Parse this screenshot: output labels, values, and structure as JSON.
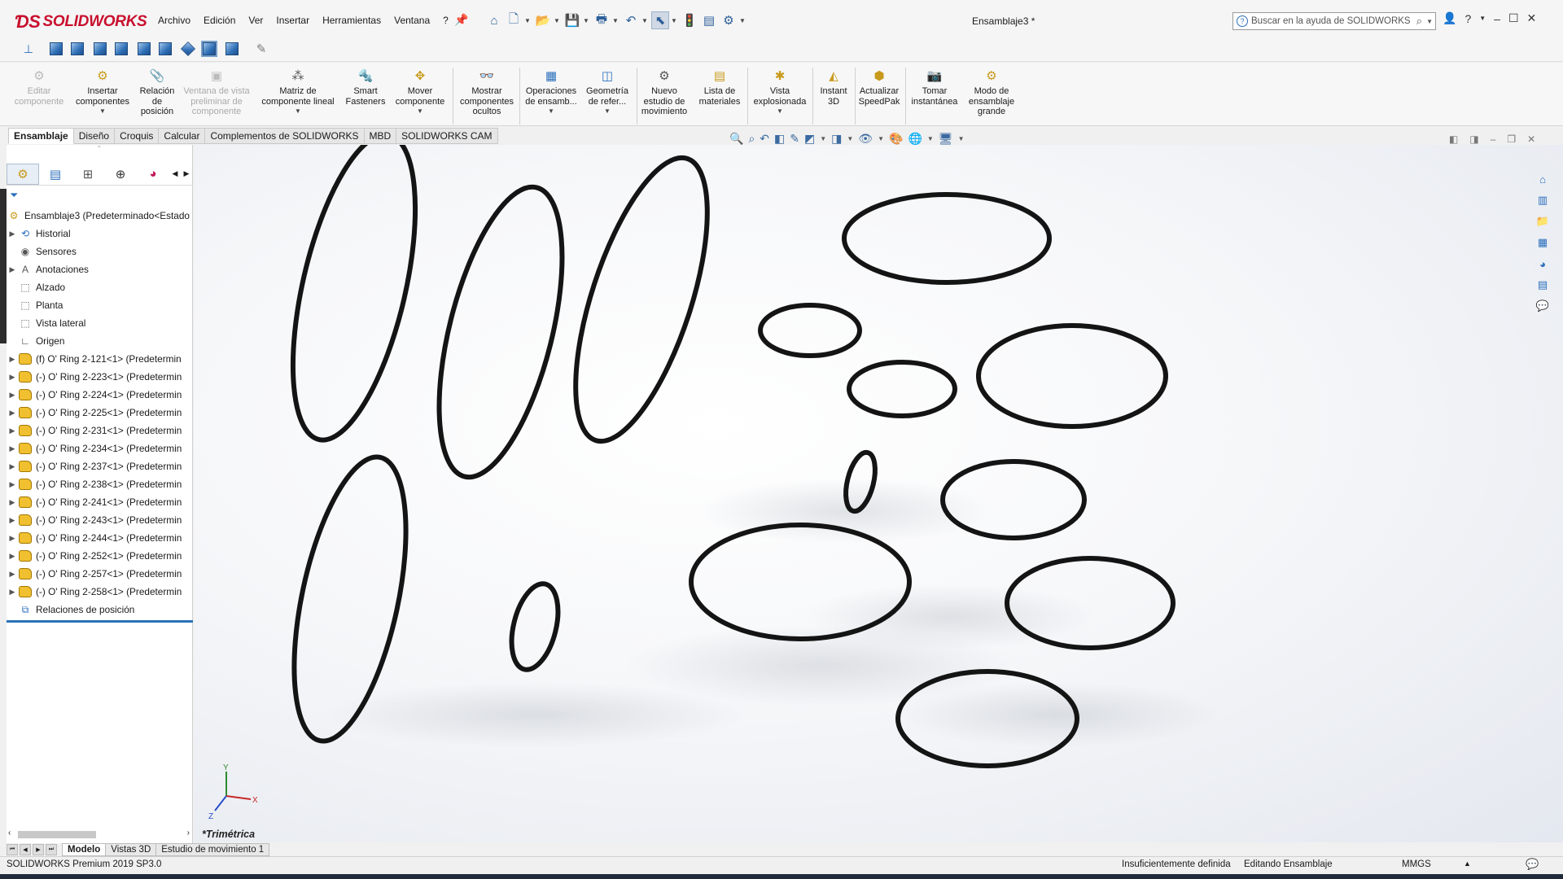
{
  "app": {
    "brand": "SOLIDWORKS",
    "document_title": "Ensamblaje3 *",
    "menu": [
      "Archivo",
      "Edición",
      "Ver",
      "Insertar",
      "Herramientas",
      "Ventana",
      "?"
    ],
    "help_search_placeholder": "Buscar en la ayuda de SOLIDWORKS"
  },
  "command_manager": {
    "items": [
      {
        "label": "Editar componente",
        "enabled": false
      },
      {
        "label": "Insertar componentes",
        "enabled": true
      },
      {
        "label": "Relación de posición",
        "enabled": true
      },
      {
        "label": "Ventana de vista preliminar de componente",
        "enabled": false
      },
      {
        "label": "Matriz de componente lineal",
        "enabled": true
      },
      {
        "label": "Smart Fasteners",
        "enabled": true
      },
      {
        "label": "Mover componente",
        "enabled": true
      },
      {
        "label": "Mostrar componentes ocultos",
        "enabled": true
      },
      {
        "label": "Operaciones de ensamb...",
        "enabled": true
      },
      {
        "label": "Geometría de refer...",
        "enabled": true
      },
      {
        "label": "Nuevo estudio de movimiento",
        "enabled": true
      },
      {
        "label": "Lista de materiales",
        "enabled": true
      },
      {
        "label": "Vista explosionada",
        "enabled": true
      },
      {
        "label": "Instant 3D",
        "enabled": true
      },
      {
        "label": "Actualizar SpeedPak",
        "enabled": true
      },
      {
        "label": "Tomar instantánea",
        "enabled": true
      },
      {
        "label": "Modo de ensamblaje grande",
        "enabled": true
      }
    ],
    "tabs": [
      "Ensamblaje",
      "Diseño",
      "Croquis",
      "Calcular",
      "Complementos de SOLIDWORKS",
      "MBD",
      "SOLIDWORKS CAM"
    ],
    "active_tab": "Ensamblaje"
  },
  "tree": {
    "root": "Ensamblaje3  (Predeterminado<Estado",
    "nodes": [
      "Historial",
      "Sensores",
      "Anotaciones",
      "Alzado",
      "Planta",
      "Vista lateral",
      "Origen",
      "(f) O' Ring 2-121<1> (Predetermin",
      "(-) O' Ring 2-223<1> (Predetermin",
      "(-) O' Ring 2-224<1> (Predetermin",
      "(-) O' Ring 2-225<1> (Predetermin",
      "(-) O' Ring 2-231<1> (Predetermin",
      "(-) O' Ring 2-234<1> (Predetermin",
      "(-) O' Ring 2-237<1> (Predetermin",
      "(-) O' Ring 2-238<1> (Predetermin",
      "(-) O' Ring 2-241<1> (Predetermin",
      "(-) O' Ring 2-243<1> (Predetermin",
      "(-) O' Ring 2-244<1> (Predetermin",
      "(-) O' Ring 2-252<1> (Predetermin",
      "(-) O' Ring 2-257<1> (Predetermin",
      "(-) O' Ring 2-258<1> (Predetermin",
      "Relaciones de posición"
    ]
  },
  "viewport": {
    "view_name": "*Trimétrica",
    "triad": {
      "x": "X",
      "y": "Y",
      "z": "Z"
    }
  },
  "bottom_tabs": [
    "Modelo",
    "Vistas 3D",
    "Estudio de movimiento 1"
  ],
  "active_bottom_tab": "Modelo",
  "status": {
    "version": "SOLIDWORKS Premium 2019 SP3.0",
    "definition": "Insuficientemente definida",
    "mode": "Editando Ensamblaje",
    "units": "MMGS"
  },
  "colors": {
    "brand": "#c8102e",
    "accent": "#2a73b8",
    "ring": "#141414"
  },
  "icons": [
    "home-icon",
    "new-file-icon",
    "open-icon",
    "save-icon",
    "print-icon",
    "undo-icon",
    "select-icon",
    "rebuild-icon",
    "options-icon",
    "pin-icon",
    "help-icon",
    "user-icon"
  ]
}
